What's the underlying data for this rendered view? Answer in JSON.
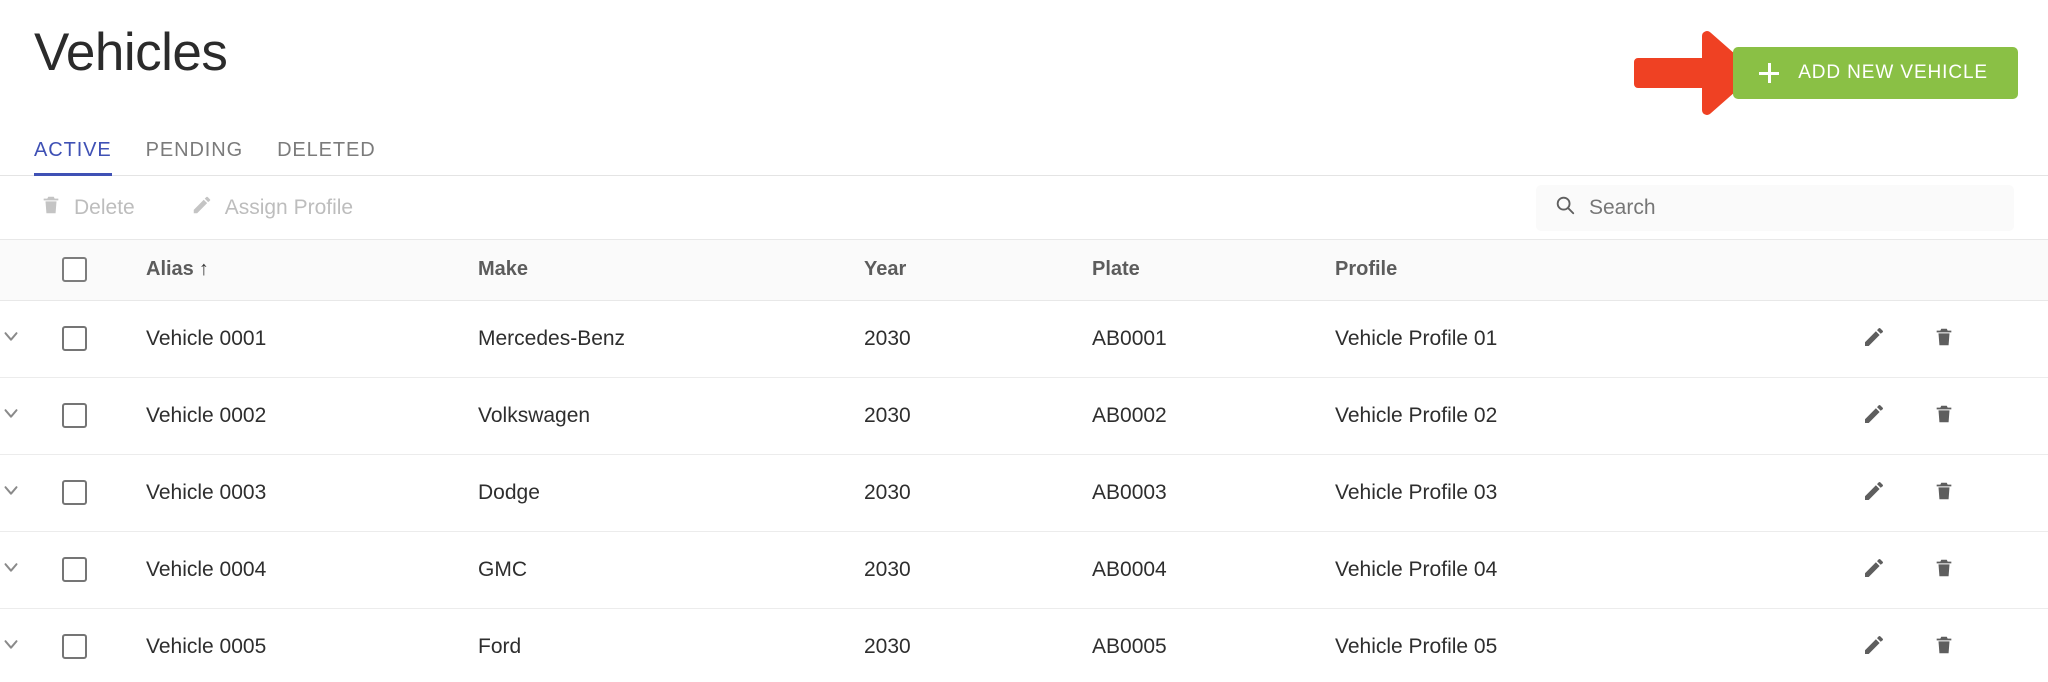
{
  "page": {
    "title": "Vehicles"
  },
  "primary_action": {
    "label": "ADD NEW VEHICLE",
    "icon": "plus-icon",
    "color": "#8ac045",
    "text_color": "#ffffff"
  },
  "annotation": {
    "type": "arrow",
    "direction": "right",
    "color": "#ef4123",
    "points_at": "ADD NEW VEHICLE"
  },
  "tabs": [
    {
      "label": "ACTIVE",
      "active": true
    },
    {
      "label": "PENDING",
      "active": false
    },
    {
      "label": "DELETED",
      "active": false
    }
  ],
  "tab_accent_color": "#3f51b5",
  "toolbar": {
    "actions": [
      {
        "label": "Delete",
        "icon": "trash-icon",
        "disabled": true
      },
      {
        "label": "Assign Profile",
        "icon": "pencil-icon",
        "disabled": true
      }
    ]
  },
  "search": {
    "placeholder": "Search",
    "value": "",
    "icon": "search-icon"
  },
  "table": {
    "select_all_checkbox": {
      "checked": false
    },
    "columns": [
      {
        "key": "alias",
        "label": "Alias",
        "sorted": true,
        "sort_direction": "↑"
      },
      {
        "key": "make",
        "label": "Make",
        "sorted": false
      },
      {
        "key": "year",
        "label": "Year",
        "sorted": false
      },
      {
        "key": "plate",
        "label": "Plate",
        "sorted": false
      },
      {
        "key": "profile",
        "label": "Profile",
        "sorted": false
      }
    ],
    "rows": [
      {
        "alias": "Vehicle 0001",
        "make": "Mercedes-Benz",
        "year": "2030",
        "plate": "AB0001",
        "profile": "Vehicle Profile 01",
        "checked": false
      },
      {
        "alias": "Vehicle 0002",
        "make": "Volkswagen",
        "year": "2030",
        "plate": "AB0002",
        "profile": "Vehicle Profile 02",
        "checked": false
      },
      {
        "alias": "Vehicle 0003",
        "make": "Dodge",
        "year": "2030",
        "plate": "AB0003",
        "profile": "Vehicle Profile 03",
        "checked": false
      },
      {
        "alias": "Vehicle 0004",
        "make": "GMC",
        "year": "2030",
        "plate": "AB0004",
        "profile": "Vehicle Profile 04",
        "checked": false
      },
      {
        "alias": "Vehicle 0005",
        "make": "Ford",
        "year": "2030",
        "plate": "AB0005",
        "profile": "Vehicle Profile 05",
        "checked": false
      }
    ],
    "row_actions": [
      {
        "name": "edit",
        "icon": "pencil-icon"
      },
      {
        "name": "delete",
        "icon": "trash-icon"
      }
    ]
  }
}
